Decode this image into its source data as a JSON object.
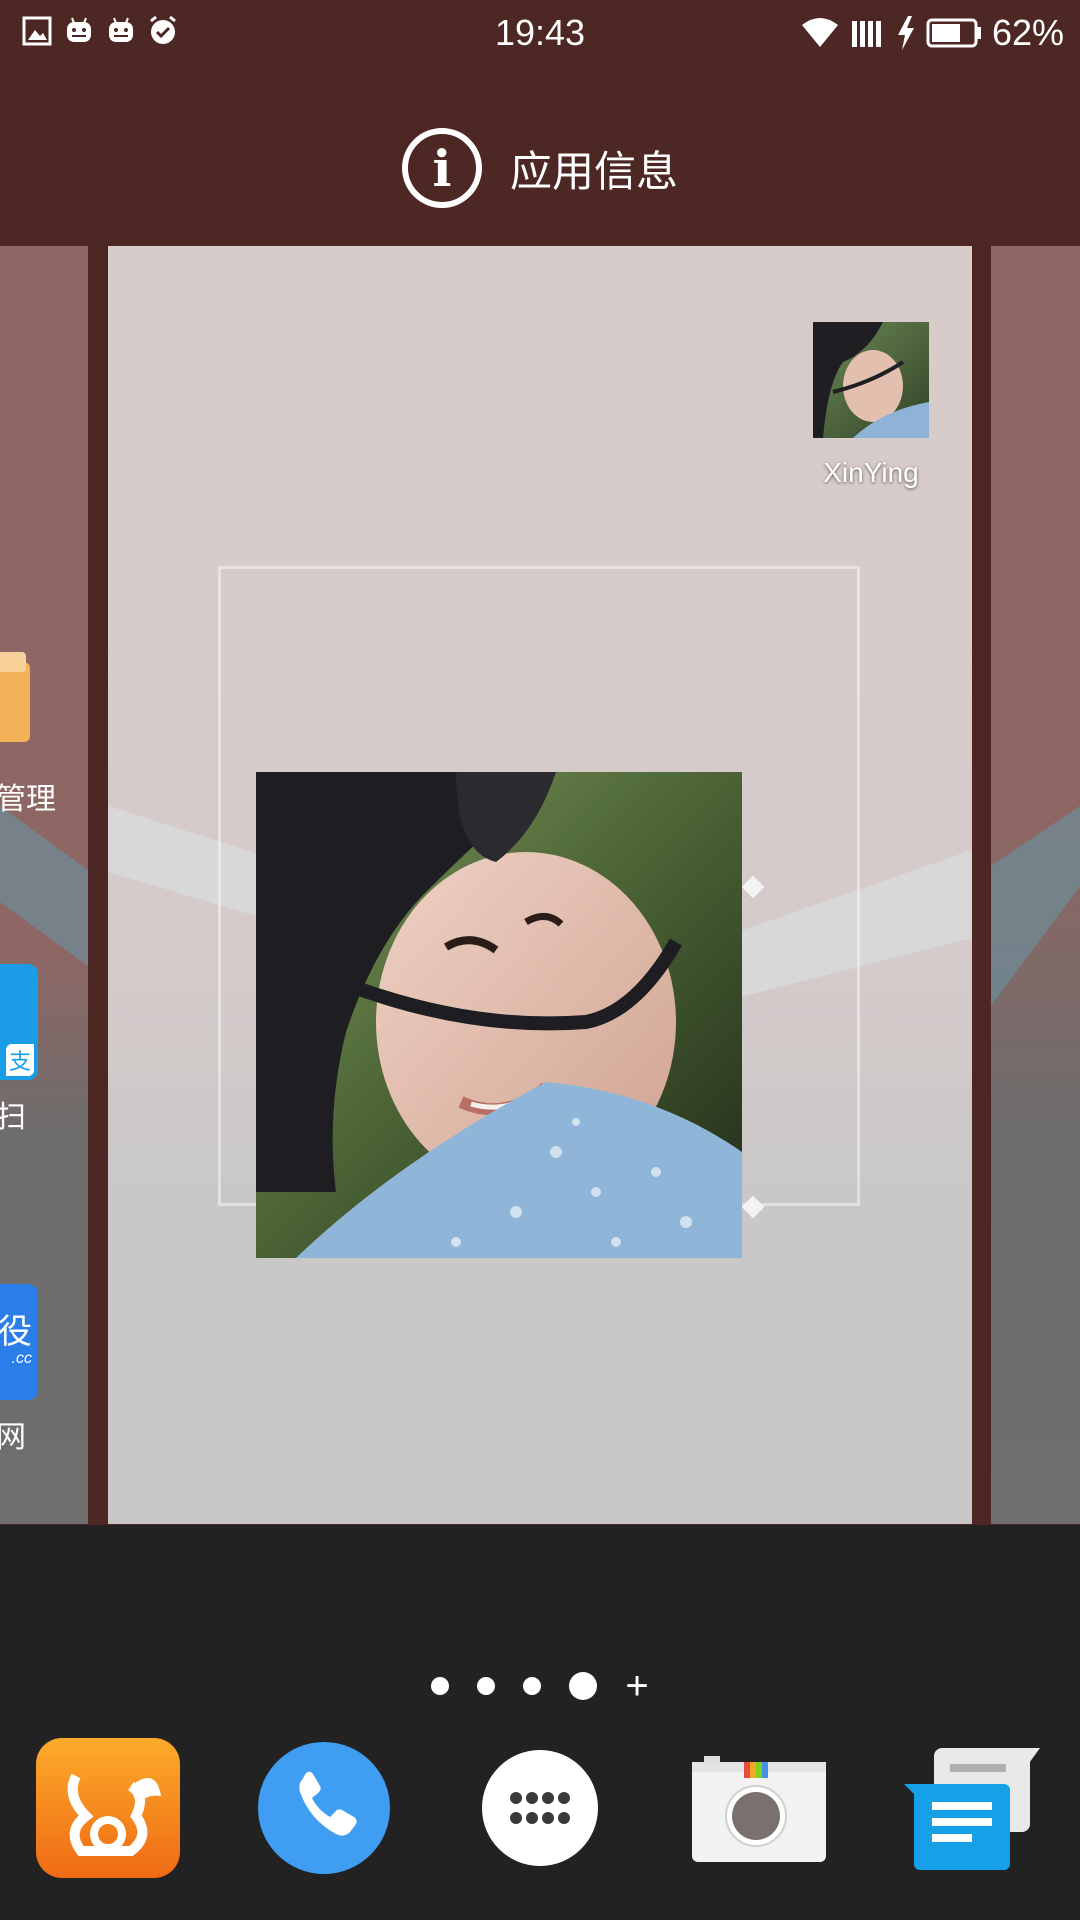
{
  "status_bar": {
    "time": "19:43",
    "battery": "62%",
    "left_icons": [
      "gallery-icon",
      "android-icon",
      "android-icon",
      "alarm-icon"
    ],
    "right_icons": [
      "wifi-icon",
      "signal-icon",
      "charging-icon",
      "battery-icon"
    ]
  },
  "header": {
    "info_icon": "info-icon",
    "label": "应用信息"
  },
  "left_peek": {
    "items": [
      {
        "label": "管理",
        "icon": "file-manager-icon"
      },
      {
        "label": "扫",
        "icon": "alipay-scan-icon"
      },
      {
        "label": "网",
        "icon": "web-icon"
      }
    ],
    "alipay_glyph": "支",
    "web_glyph": "役",
    "web_sub": ".cc"
  },
  "page": {
    "shortcut_label": "XinYing",
    "widget": "photo-widget"
  },
  "pager": {
    "pages": 4,
    "active_page": 4,
    "add_label": "+"
  },
  "dock": {
    "apps": [
      {
        "name": "uc-browser-icon"
      },
      {
        "name": "phone-icon"
      },
      {
        "name": "app-drawer-icon"
      },
      {
        "name": "camera-icon"
      },
      {
        "name": "messages-icon"
      }
    ]
  },
  "colors": {
    "wallpaper_top": "#4d2723",
    "dock_bg": "#222222",
    "card_bg": "#d8cccb",
    "phone_blue": "#3f9ef2",
    "uc_orange": "#f5831f",
    "msg_blue": "#16a0e8"
  }
}
